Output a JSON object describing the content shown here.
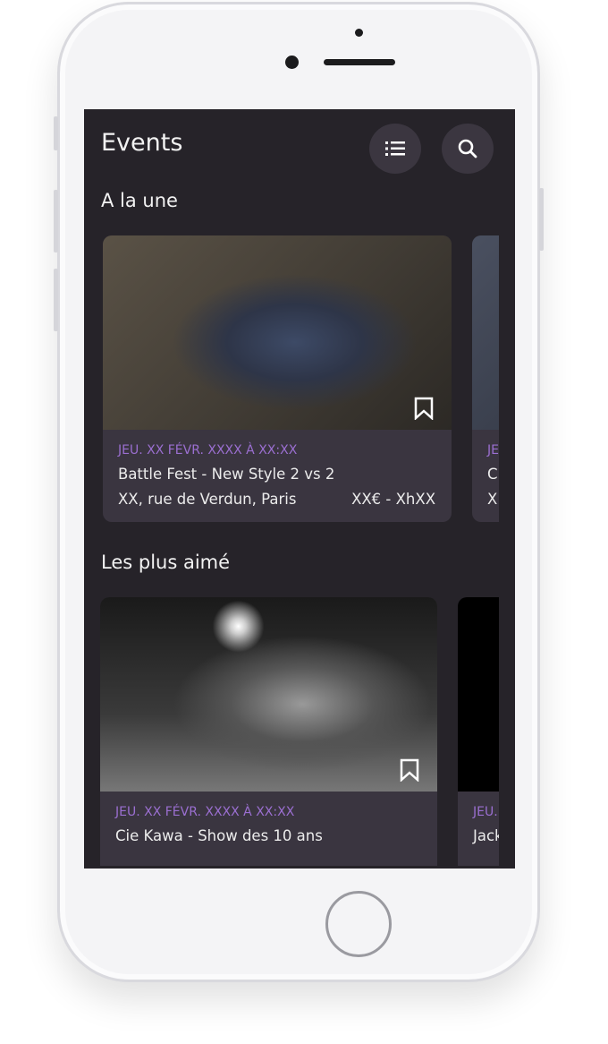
{
  "header": {
    "title": "Events",
    "list_icon": "list-icon",
    "search_icon": "search-icon"
  },
  "sections": [
    {
      "title": "A la une",
      "cards": [
        {
          "date": "JEU. XX FÉVR. XXXX À XX:XX",
          "name": "Battle Fest - New Style 2 vs 2",
          "address": "XX, rue de Verdun, Paris",
          "price": "XX€ - XhXX"
        },
        {
          "date": "JE",
          "name": "C",
          "address": "X"
        }
      ]
    },
    {
      "title": "Les plus aimé",
      "cards": [
        {
          "date": "JEU. XX FÉVR. XXXX À XX:XX",
          "name": "Cie Kawa - Show des 10 ans"
        },
        {
          "date": "JEU.",
          "name": "Jack"
        }
      ]
    }
  ],
  "colors": {
    "accent": "#9b6fd1",
    "background": "#262329",
    "card": "#3a3540"
  }
}
